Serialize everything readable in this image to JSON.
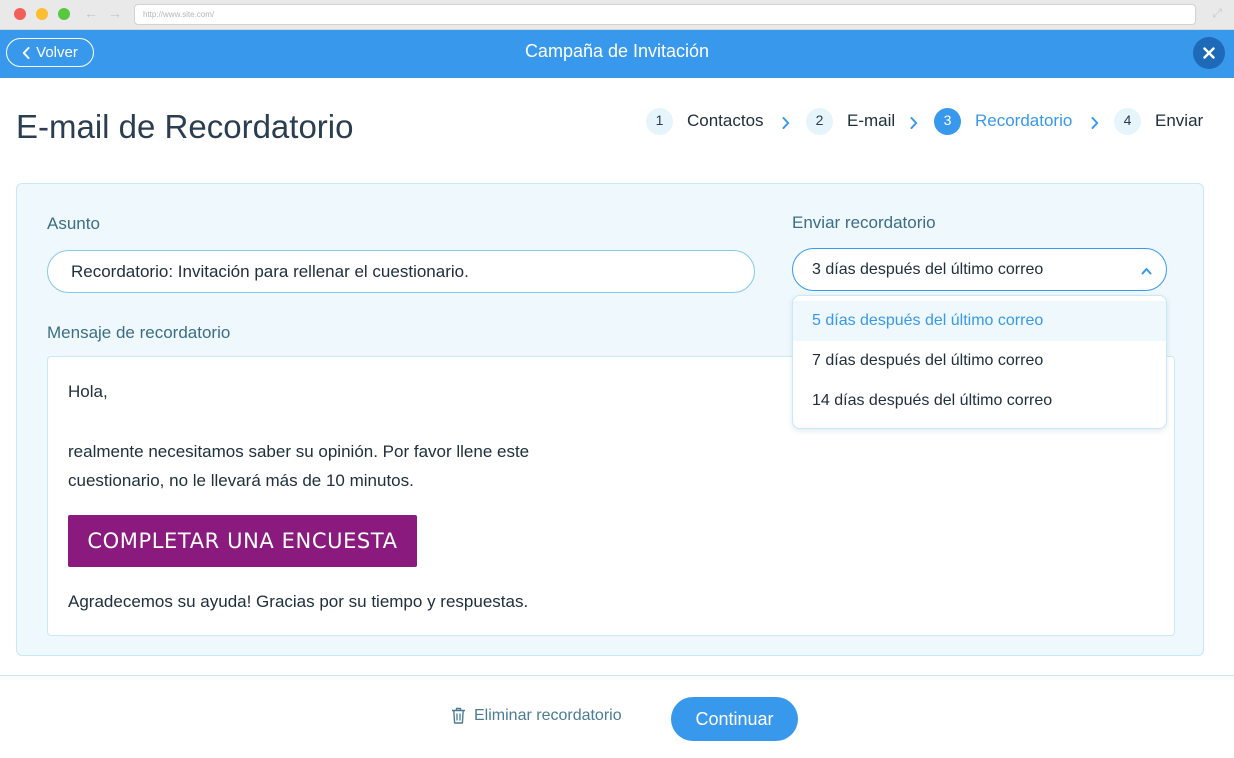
{
  "browser": {
    "url": "http://www.site.com/"
  },
  "header": {
    "back_label": "Volver",
    "title": "Campaña de Invitación",
    "close_icon": "close-icon",
    "bg_color": "#3899ec"
  },
  "page": {
    "title": "E-mail de Recordatorio"
  },
  "steps": [
    {
      "number": "1",
      "label": "Contactos",
      "active": false
    },
    {
      "number": "2",
      "label": "E-mail",
      "active": false
    },
    {
      "number": "3",
      "label": "Recordatorio",
      "active": true
    },
    {
      "number": "4",
      "label": "Enviar",
      "active": false
    }
  ],
  "form": {
    "subject_label": "Asunto",
    "subject_value": "Recordatorio: Invitación para rellenar el cuestionario.",
    "send_label": "Enviar recordatorio",
    "send_selected": "3 días después del último correo",
    "send_options": [
      "5 días después del último correo",
      "7 días después del último correo",
      "14 días después del último correo"
    ],
    "message_label": "Mensaje de recordatorio"
  },
  "message": {
    "greeting": "Hola,",
    "body_line1": "realmente necesitamos saber su opinión. Por favor llene este",
    "body_line2": "cuestionario, no le llevará más de 10 minutos.",
    "survey_button": "COMPLETAR UNA ENCUESTA",
    "survey_button_color": "#8a1a7d",
    "closing": "Agradecemos su ayuda! Gracias por su tiempo y respuestas."
  },
  "footer": {
    "delete_label": "Eliminar recordatorio",
    "delete_icon": "trash-icon",
    "continue_label": "Continuar"
  }
}
